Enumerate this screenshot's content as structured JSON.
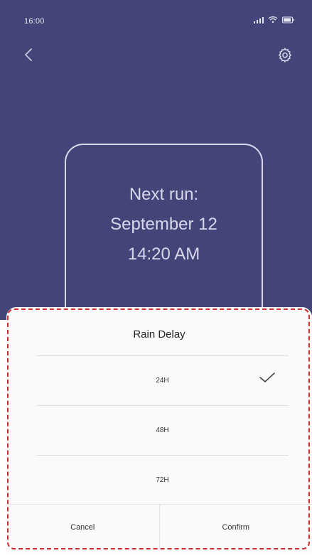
{
  "status_bar": {
    "time": "16:00",
    "signal_icon": "signal-icon",
    "wifi_icon": "wifi-icon",
    "battery_icon": "battery-icon"
  },
  "header": {
    "back_icon": "back-arrow-icon",
    "settings_icon": "gear-icon"
  },
  "next_run": {
    "line1": "Next run:",
    "line2": "September 12",
    "line3": "14:20 AM"
  },
  "sheet": {
    "title": "Rain Delay",
    "options": [
      {
        "label": "24H"
      },
      {
        "label": "48H"
      },
      {
        "label": "72H"
      }
    ],
    "cancel_label": "Cancel",
    "confirm_label": "Confirm"
  },
  "colors": {
    "header_bg": "#434478",
    "sheet_bg": "#fafafa",
    "outline": "#cc2d2d"
  }
}
